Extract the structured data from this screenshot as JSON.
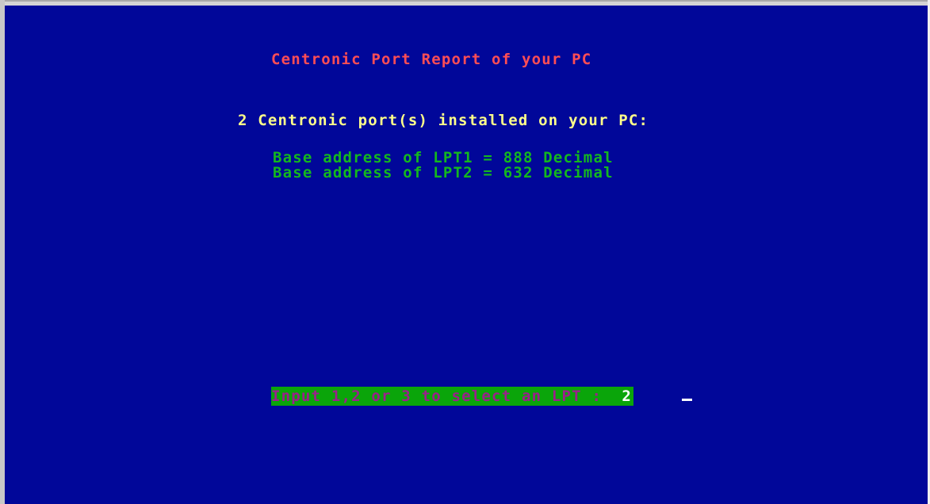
{
  "screen": {
    "title": "Centronic Port Report of your PC",
    "subtitle": "2 Centronic port(s) installed on your PC:",
    "ports": [
      "Base address of LPT1 = 888 Decimal",
      "Base address of LPT2 = 632 Decimal"
    ],
    "prompt": {
      "label": "Input 1,2 or 3 to select an LPT :  ",
      "value": "2"
    }
  },
  "colors": {
    "background": "#010799",
    "title": "#ff4d55",
    "subtitle": "#ffff8a",
    "ports": "#14b81e",
    "prompt_bar": "#0aa50a",
    "prompt_text": "#9c1f8c",
    "cursor": "#ffffff"
  }
}
